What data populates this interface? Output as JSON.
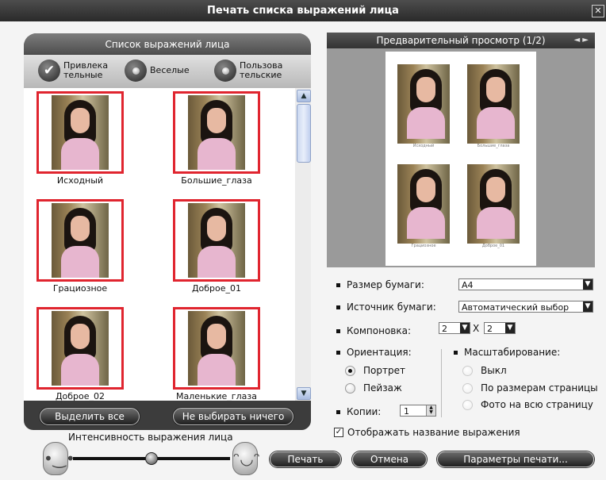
{
  "window": {
    "title": "Печать списка выражений лица",
    "close_glyph": "✕"
  },
  "list_panel": {
    "title": "Список выражений лица",
    "filters": [
      {
        "line1": "Привлека",
        "line2": "тельные",
        "checked": true
      },
      {
        "line1": "Веселые",
        "line2": "",
        "checked": false
      },
      {
        "line1": "Пользова",
        "line2": "тельские",
        "checked": false
      }
    ],
    "thumbnails": [
      {
        "caption": "Исходный"
      },
      {
        "caption": "Большие_глаза"
      },
      {
        "caption": "Грациозное"
      },
      {
        "caption": "Доброе_01"
      },
      {
        "caption": "Доброе_02"
      },
      {
        "caption": "Маленькие_глаза"
      }
    ],
    "select_all_label": "Выделить все",
    "select_none_label": "Не выбирать ничего"
  },
  "intensity": {
    "label": "Интенсивность выражения лица",
    "level": 0.48
  },
  "preview": {
    "title": "Предварительный просмотр (1/2)",
    "nav": "◄ ►",
    "mini_captions": [
      "Исходный",
      "Большие_глаза",
      "Грациозное",
      "Доброе_01"
    ]
  },
  "settings": {
    "paper_size_label": "Размер бумаги:",
    "paper_size_value": "A4",
    "paper_source_label": "Источник бумаги:",
    "paper_source_value": "Автоматический выбор",
    "layout_label": "Компоновка:",
    "layout_cols": "2",
    "layout_x": "X",
    "layout_rows": "2",
    "orientation_label": "Ориентация:",
    "orientation_options": [
      "Портрет",
      "Пейзаж"
    ],
    "orientation_selected": "Портрет",
    "scaling_label": "Масштабирование:",
    "scaling_options": [
      "Выкл",
      "По размерам страницы",
      "Фото на всю страницу"
    ],
    "copies_label": "Копии:",
    "copies_value": "1",
    "show_name_label": "Отображать название выражения",
    "show_name_checked": true
  },
  "buttons": {
    "print": "Печать",
    "cancel": "Отмена",
    "print_params": "Параметры печати..."
  }
}
